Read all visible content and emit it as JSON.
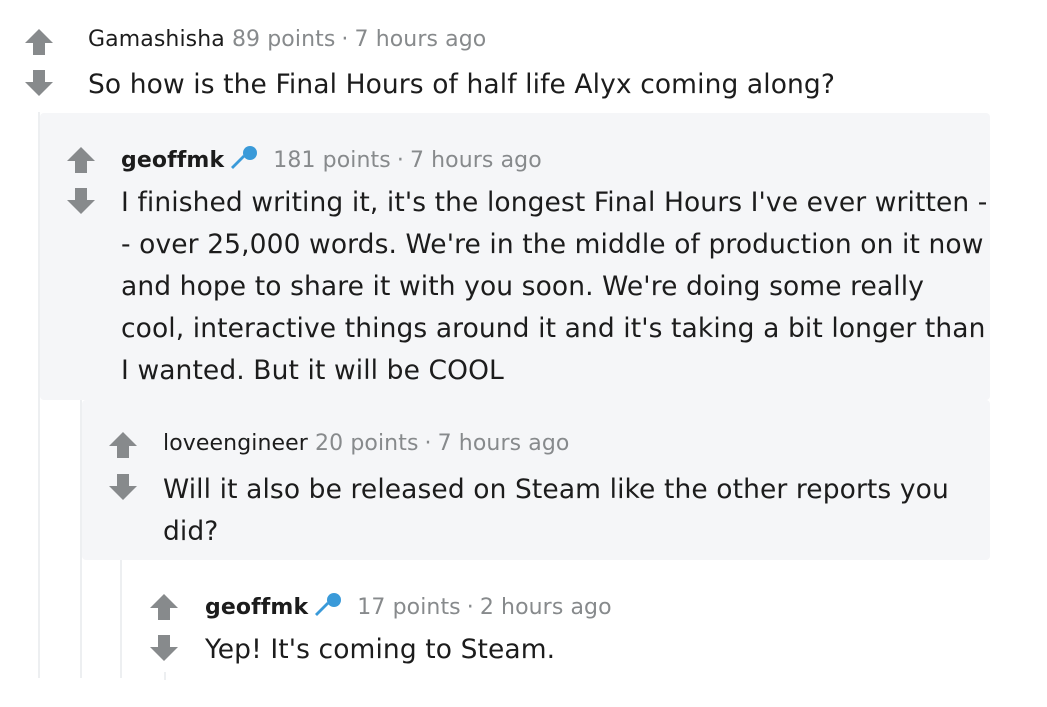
{
  "comments": [
    {
      "author": "Gamashisha",
      "points": "89 points",
      "separator": "·",
      "time": "7 hours ago",
      "body_lines": [
        "So how is the Final Hours of half life Alyx coming along?"
      ]
    },
    {
      "author": "geoffmk",
      "flair_icon": "microphone-icon",
      "points": "181 points",
      "separator": "·",
      "time": "7 hours ago",
      "body_lines": [
        "I finished writing it, it's the longest Final Hours I've ever written -",
        "- over 25,000 words. We're in the middle of production on it now",
        "and hope to share it with you soon. We're doing some really",
        "cool, interactive things around it and it's taking a bit longer than",
        "I wanted. But it will be COOL"
      ]
    },
    {
      "author": "loveengineer",
      "points": "20 points",
      "separator": "·",
      "time": "7 hours ago",
      "body_lines": [
        "Will it also be released on Steam like the other reports you",
        "did?"
      ]
    },
    {
      "author": "geoffmk",
      "flair_icon": "microphone-icon",
      "points": "17 points",
      "separator": "·",
      "time": "2 hours ago",
      "body_lines": [
        "Yep! It's coming to Steam."
      ]
    }
  ],
  "colors": {
    "vote_arrow": "#878a8c",
    "mic_blue": "#3a9ad9",
    "nested_bg": "#f5f6f8",
    "thread_line": "#edeff1"
  }
}
